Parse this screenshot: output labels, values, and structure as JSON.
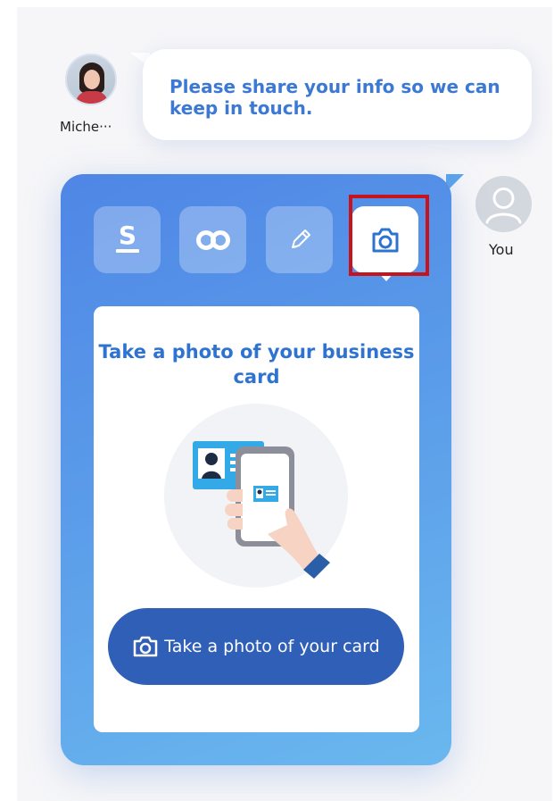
{
  "agent": {
    "name": "Miche···",
    "message": "Please share your info so we can keep in touch."
  },
  "user": {
    "label": "You"
  },
  "tabs": [
    {
      "icon": "sansan-s-icon",
      "active": false
    },
    {
      "icon": "link-infinity-icon",
      "active": false
    },
    {
      "icon": "pencil-icon",
      "active": false
    },
    {
      "icon": "camera-icon",
      "active": true
    }
  ],
  "card": {
    "title": "Take a photo of your business card",
    "illustration": "phone-scanning-business-card",
    "button_label": "Take a photo of your card",
    "button_icon": "camera-icon"
  },
  "colors": {
    "accent_blue": "#2f73d0",
    "panel_gradient_start": "#4f86e6",
    "panel_gradient_end": "#6ab8ef",
    "button_blue": "#2f5fb6",
    "highlight_red": "#c7141c"
  }
}
